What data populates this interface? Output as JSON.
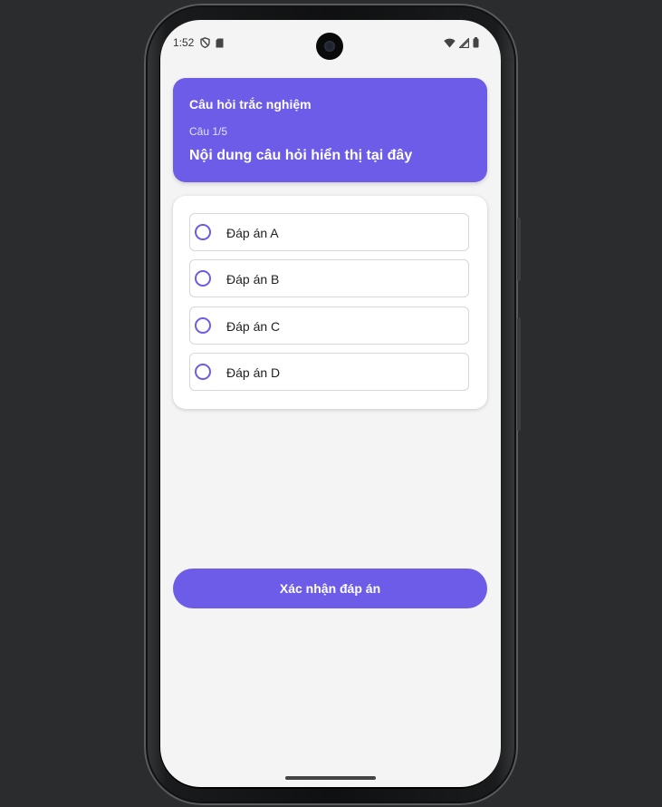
{
  "status_bar": {
    "time": "1:52"
  },
  "quiz": {
    "app_title": "Câu hỏi trắc nghiệm",
    "progress": "Câu 1/5",
    "question": "Nội dung câu hỏi hiển thị tại đây",
    "options": [
      {
        "label": "Đáp án A",
        "selected": false
      },
      {
        "label": "Đáp án B",
        "selected": false
      },
      {
        "label": "Đáp án C",
        "selected": false
      },
      {
        "label": "Đáp án D",
        "selected": false
      }
    ],
    "submit_label": "Xác nhận đáp án"
  },
  "colors": {
    "accent": "#6c5ce7",
    "background": "#f4f4f4",
    "card": "#ffffff"
  },
  "icons": {
    "status_left": [
      "shield-icon",
      "sd-card-icon"
    ],
    "status_right": [
      "wifi-icon",
      "cellular-signal-icon",
      "battery-icon"
    ]
  }
}
